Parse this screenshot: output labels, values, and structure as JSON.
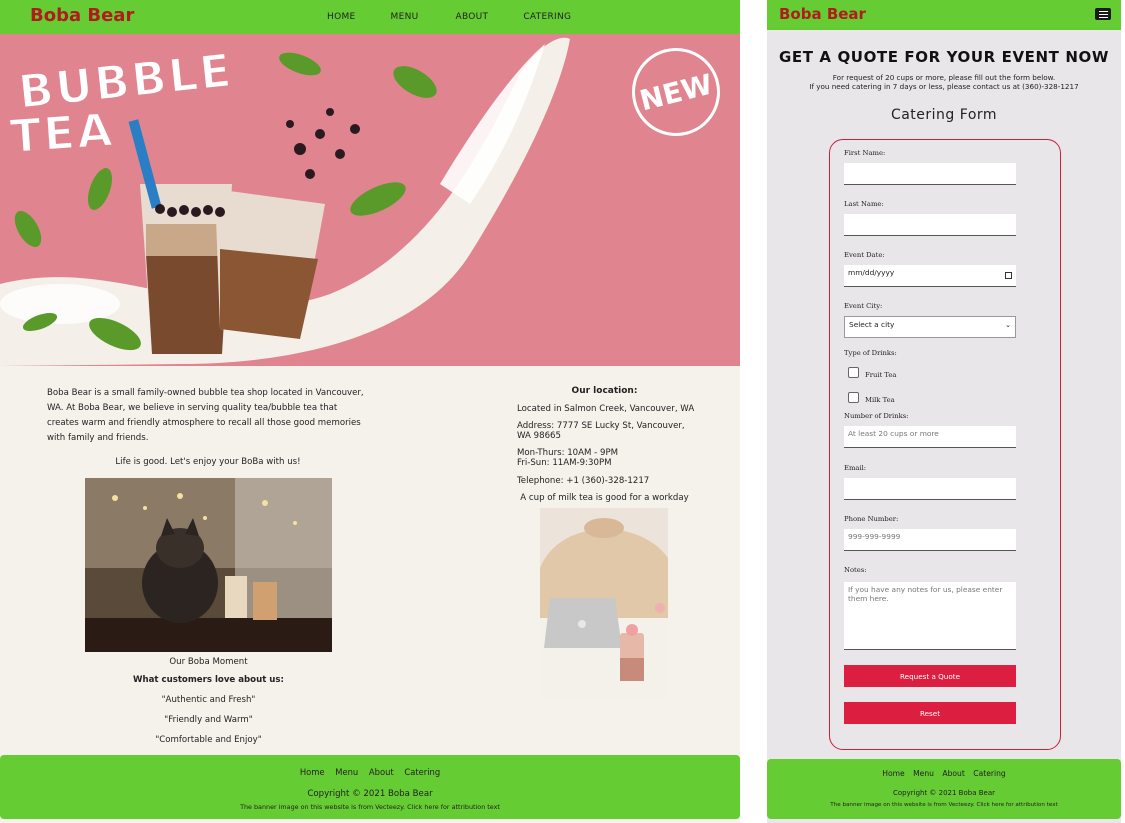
{
  "site": {
    "brand": "Boba Bear",
    "nav": [
      "HOME",
      "MENU",
      "ABOUT",
      "CATERING"
    ]
  },
  "banner": {
    "line1": "BUBBLE",
    "line2": "TEA",
    "stamp": "NEW"
  },
  "home": {
    "intro": "Boba Bear is a small family-owned bubble tea shop located in Vancouver, WA. At Boba Bear, we believe in serving quality tea/bubble tea that creates warm and friendly atmosphere to recall all those good memories with family and friends.",
    "tagline": "Life is good. Let's enjoy your BoBa with us!",
    "photo1_caption": "Our Boba Moment",
    "love_heading": "What customers love about us:",
    "quotes": [
      "\"Authentic and Fresh\"",
      "\"Friendly and Warm\"",
      "\"Comfortable and Enjoy\""
    ],
    "location_title": "Our location:",
    "location_line": "Located in Salmon Creek, Vancouver, WA",
    "address_1": "Address: 7777 SE Lucky St, Vancouver,",
    "address_2": "WA 98665",
    "hours_1": "Mon-Thurs: 10AM - 9PM",
    "hours_2": "Fri-Sun: 11AM-9:30PM",
    "telephone": "Telephone: +1 (360)-328-1217",
    "photo2_caption": "A cup of milk tea is good for a workday"
  },
  "footer": {
    "links": [
      "Home",
      "Menu",
      "About",
      "Catering"
    ],
    "copyright": "Copyright © 2021 Boba Bear",
    "attribution": "The banner image on this website is from Vecteezy. Click here for attribution text"
  },
  "catering": {
    "heading": "GET A QUOTE FOR YOUR EVENT NOW",
    "sub1": "For request of 20 cups or more, please fill out the form below.",
    "sub2": "If you need catering in 7 days or less, please contact us at (360)-328-1217",
    "form_title": "Catering Form",
    "labels": {
      "first_name": "First Name:",
      "last_name": "Last Name:",
      "event_date": "Event Date:",
      "event_city": "Event City:",
      "drinks": "Type of Drinks:",
      "fruit_tea": "Fruit Tea",
      "milk_tea": "Milk Tea",
      "num_drinks": "Number of Drinks:",
      "email": "Email:",
      "phone": "Phone Number:",
      "notes": "Notes:"
    },
    "placeholders": {
      "date": "mm/dd/yyyy",
      "city": "Select a city",
      "num_drinks": "At least 20 cups or more",
      "phone": "999-999-9999",
      "notes": "If you have any notes for us, please enter them here."
    },
    "buttons": {
      "submit": "Request a Quote",
      "reset": "Reset"
    }
  },
  "colors": {
    "green": "#66cc33",
    "brand_red": "#b01c1c",
    "button_red": "#dc1f41",
    "banner_pink": "#e08590"
  }
}
